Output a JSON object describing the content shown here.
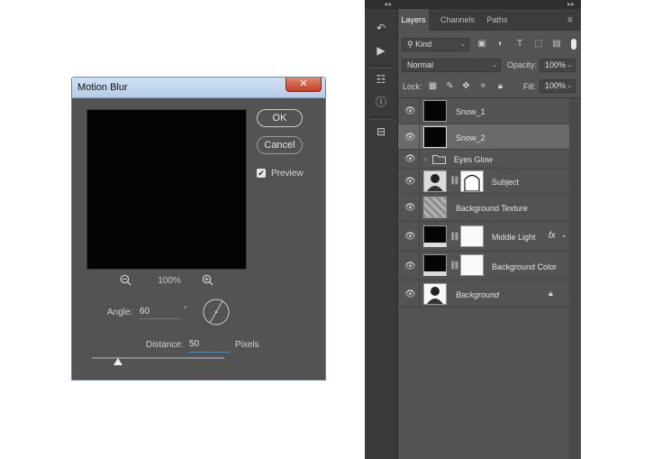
{
  "dialog": {
    "title": "Motion Blur",
    "close_glyph": "✕",
    "ok_label": "OK",
    "cancel_label": "Cancel",
    "preview_label": "Preview",
    "preview_checked": true,
    "zoom_level": "100%",
    "angle_label": "Angle:",
    "angle_value": "60",
    "degree_symbol": "°",
    "distance_label": "Distance:",
    "distance_value": "50",
    "distance_unit": "Pixels",
    "slider_level": 0.2
  },
  "panel": {
    "collapse_left": "◂◂",
    "collapse_right": "▸▸",
    "tabs": [
      "Layers",
      "Channels",
      "Paths"
    ],
    "menu_icon": "hamburger-menu-icon",
    "filter_kind": "Kind",
    "blend_mode": "Normal",
    "opacity_label": "Opacity:",
    "opacity_value": "100%",
    "lock_label": "Lock:",
    "fill_label": "Fill:",
    "fill_value": "100%"
  },
  "layers": [
    {
      "name": "Snow_1",
      "thumb": "black",
      "selected": false,
      "visible": true
    },
    {
      "name": "Snow_2",
      "thumb": "black",
      "selected": true,
      "visible": true
    },
    {
      "name": "Eyes Glow",
      "type": "group",
      "visible": true
    },
    {
      "name": "Subject",
      "thumb": "checker",
      "mask": true,
      "visible": true
    },
    {
      "name": "Background Texture",
      "thumb": "texture",
      "visible": true
    },
    {
      "name": "Middle Light",
      "thumb": "black-adjust",
      "mask": true,
      "fx": "fx",
      "visible": true
    },
    {
      "name": "Background Color",
      "thumb": "black-adjust",
      "mask": true,
      "visible": true
    },
    {
      "name": "Background",
      "thumb": "photo",
      "italic": true,
      "locked": true,
      "visible": true
    }
  ],
  "colors": {
    "dialog_bg": "#535353",
    "panel_bg": "#535353",
    "selected_row": "#6a6a6a",
    "distance_focus": "#3f8fe0"
  }
}
